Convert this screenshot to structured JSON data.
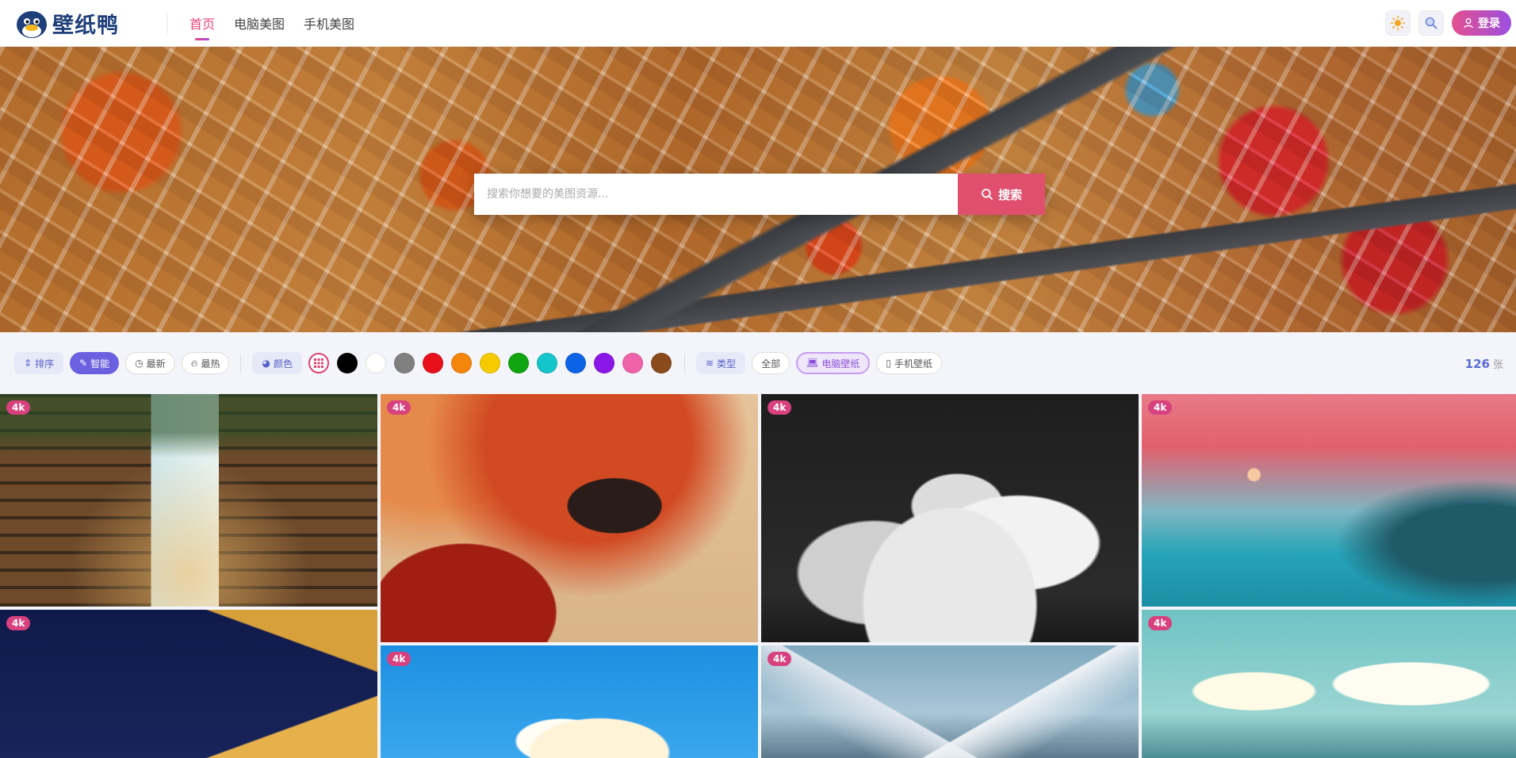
{
  "brand": {
    "name": "壁纸鸭"
  },
  "nav": {
    "items": [
      "首页",
      "电脑美图",
      "手机美图"
    ],
    "active": 0
  },
  "header": {
    "login_label": "登录"
  },
  "hero": {
    "search_placeholder": "搜索你想要的美图资源...",
    "search_button": "搜索"
  },
  "filters": {
    "sort_label": "排序",
    "sort_options": [
      "智能",
      "最新",
      "最热"
    ],
    "color_label": "颜色",
    "colors": [
      "#000000",
      "#ffffff",
      "#808080",
      "#e8101b",
      "#f5860c",
      "#f5cb00",
      "#11a611",
      "#14c6cc",
      "#0d63e6",
      "#8b16e8",
      "#f062a9",
      "#8a4a1c"
    ],
    "type_label": "类型",
    "type_options": [
      "全部",
      "电脑壁纸",
      "手机壁纸"
    ],
    "count": "126",
    "count_unit": "张"
  },
  "badges": {
    "quality": "4k"
  },
  "colors": {
    "accent": "#e8467c",
    "primary": "#6b61e0"
  }
}
